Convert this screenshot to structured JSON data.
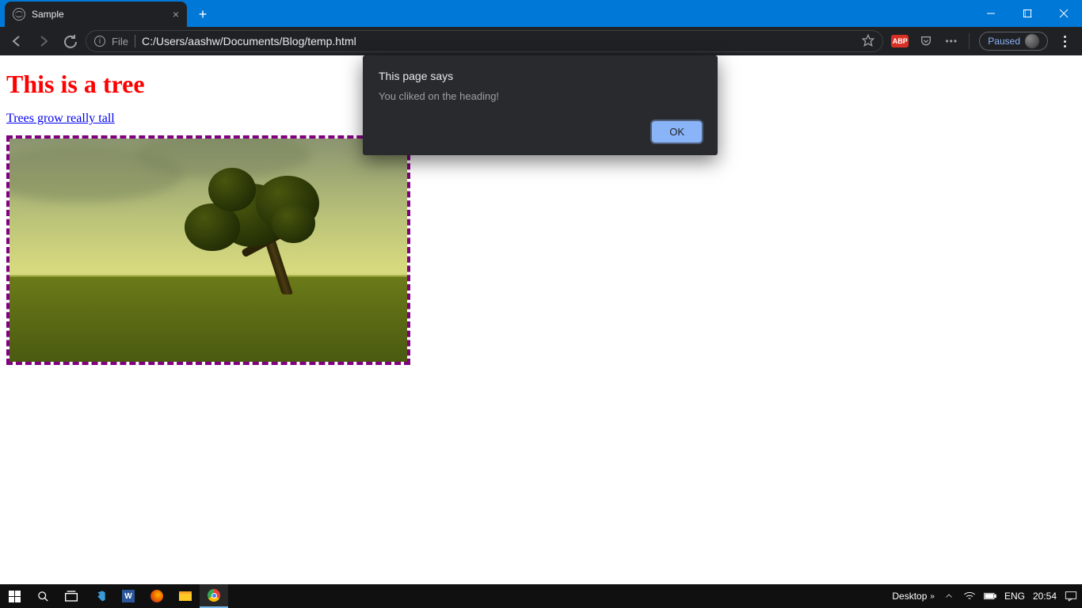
{
  "browser": {
    "tab_title": "Sample",
    "url_scheme_label": "File",
    "url": "C:/Users/aashw/Documents/Blog/temp.html",
    "paused_label": "Paused"
  },
  "page": {
    "heading": "This is a tree",
    "link_text": "Trees grow really tall"
  },
  "alert": {
    "title": "This page says",
    "message": "You cliked on the heading!",
    "ok_label": "OK"
  },
  "taskbar": {
    "desktop_label": "Desktop",
    "lang": "ENG",
    "time": "20:54"
  }
}
